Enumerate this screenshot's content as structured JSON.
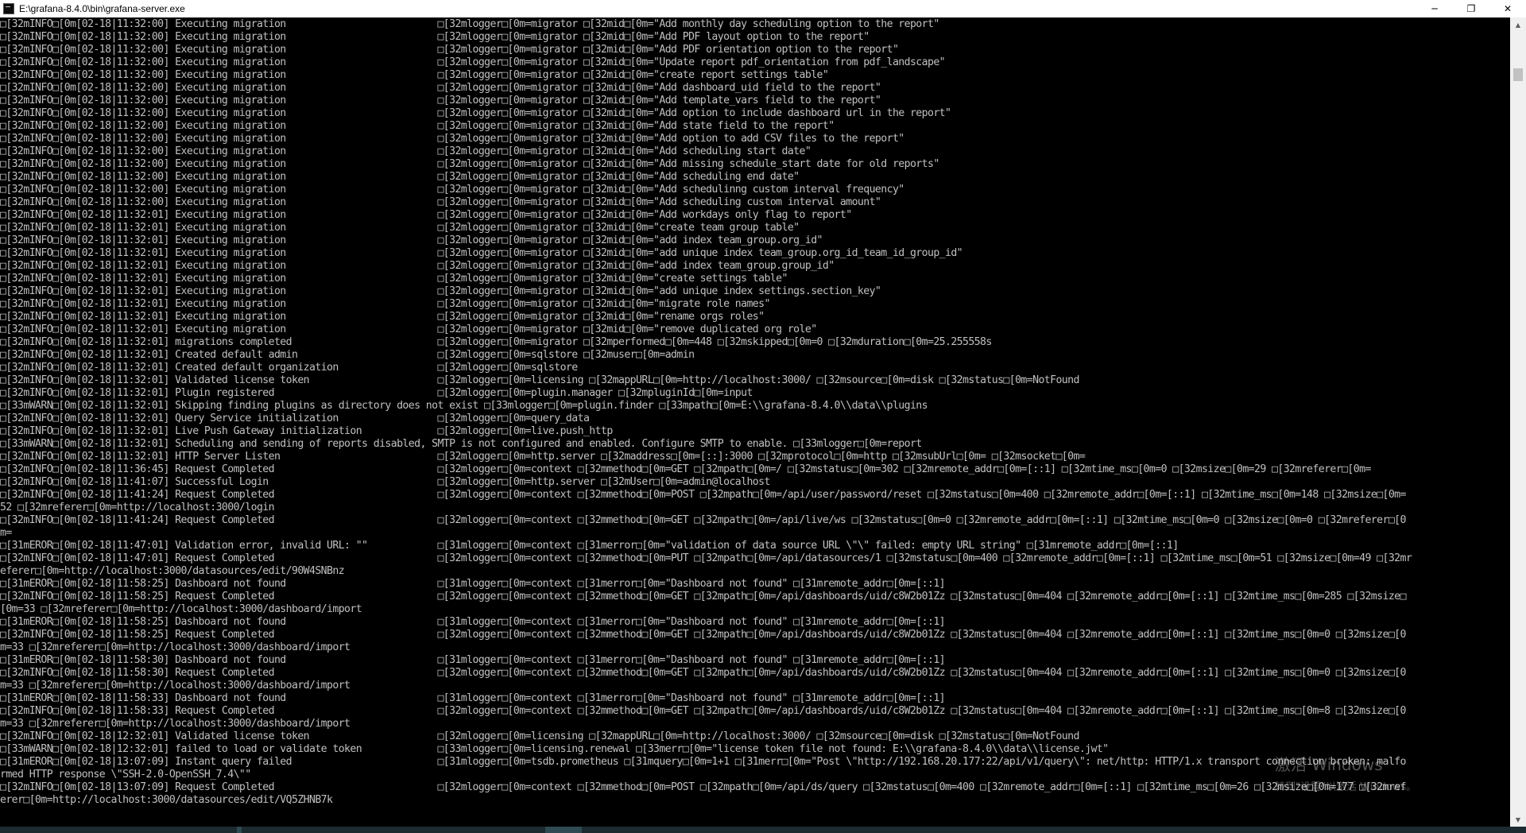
{
  "window": {
    "title": "E:\\grafana-8.4.0\\bin\\grafana-server.exe",
    "minimize_glyph": "─",
    "maximize_glyph": "❐",
    "close_glyph": "✕"
  },
  "console": {
    "lines": [
      "□[32mINFO□[0m[02-18|11:32:00] Executing migration                          □[32mlogger□[0m=migrator □[32mid□[0m=\"Add monthly day scheduling option to the report\"",
      "□[32mINFO□[0m[02-18|11:32:00] Executing migration                          □[32mlogger□[0m=migrator □[32mid□[0m=\"Add PDF layout option to the report\"",
      "□[32mINFO□[0m[02-18|11:32:00] Executing migration                          □[32mlogger□[0m=migrator □[32mid□[0m=\"Add PDF orientation option to the report\"",
      "□[32mINFO□[0m[02-18|11:32:00] Executing migration                          □[32mlogger□[0m=migrator □[32mid□[0m=\"Update report pdf_orientation from pdf_landscape\"",
      "□[32mINFO□[0m[02-18|11:32:00] Executing migration                          □[32mlogger□[0m=migrator □[32mid□[0m=\"create report settings table\"",
      "□[32mINFO□[0m[02-18|11:32:00] Executing migration                          □[32mlogger□[0m=migrator □[32mid□[0m=\"Add dashboard_uid field to the report\"",
      "□[32mINFO□[0m[02-18|11:32:00] Executing migration                          □[32mlogger□[0m=migrator □[32mid□[0m=\"Add template_vars field to the report\"",
      "□[32mINFO□[0m[02-18|11:32:00] Executing migration                          □[32mlogger□[0m=migrator □[32mid□[0m=\"Add option to include dashboard url in the report\"",
      "□[32mINFO□[0m[02-18|11:32:00] Executing migration                          □[32mlogger□[0m=migrator □[32mid□[0m=\"Add state field to the report\"",
      "□[32mINFO□[0m[02-18|11:32:00] Executing migration                          □[32mlogger□[0m=migrator □[32mid□[0m=\"Add option to add CSV files to the report\"",
      "□[32mINFO□[0m[02-18|11:32:00] Executing migration                          □[32mlogger□[0m=migrator □[32mid□[0m=\"Add scheduling start date\"",
      "□[32mINFO□[0m[02-18|11:32:00] Executing migration                          □[32mlogger□[0m=migrator □[32mid□[0m=\"Add missing schedule_start date for old reports\"",
      "□[32mINFO□[0m[02-18|11:32:00] Executing migration                          □[32mlogger□[0m=migrator □[32mid□[0m=\"Add scheduling end date\"",
      "□[32mINFO□[0m[02-18|11:32:00] Executing migration                          □[32mlogger□[0m=migrator □[32mid□[0m=\"Add schedulinng custom interval frequency\"",
      "□[32mINFO□[0m[02-18|11:32:00] Executing migration                          □[32mlogger□[0m=migrator □[32mid□[0m=\"Add scheduling custom interval amount\"",
      "□[32mINFO□[0m[02-18|11:32:01] Executing migration                          □[32mlogger□[0m=migrator □[32mid□[0m=\"Add workdays only flag to report\"",
      "□[32mINFO□[0m[02-18|11:32:01] Executing migration                          □[32mlogger□[0m=migrator □[32mid□[0m=\"create team group table\"",
      "□[32mINFO□[0m[02-18|11:32:01] Executing migration                          □[32mlogger□[0m=migrator □[32mid□[0m=\"add index team_group.org_id\"",
      "□[32mINFO□[0m[02-18|11:32:01] Executing migration                          □[32mlogger□[0m=migrator □[32mid□[0m=\"add unique index team_group.org_id_team_id_group_id\"",
      "□[32mINFO□[0m[02-18|11:32:01] Executing migration                          □[32mlogger□[0m=migrator □[32mid□[0m=\"add index team_group.group_id\"",
      "□[32mINFO□[0m[02-18|11:32:01] Executing migration                          □[32mlogger□[0m=migrator □[32mid□[0m=\"create settings table\"",
      "□[32mINFO□[0m[02-18|11:32:01] Executing migration                          □[32mlogger□[0m=migrator □[32mid□[0m=\"add unique index settings.section_key\"",
      "□[32mINFO□[0m[02-18|11:32:01] Executing migration                          □[32mlogger□[0m=migrator □[32mid□[0m=\"migrate role names\"",
      "□[32mINFO□[0m[02-18|11:32:01] Executing migration                          □[32mlogger□[0m=migrator □[32mid□[0m=\"rename orgs roles\"",
      "□[32mINFO□[0m[02-18|11:32:01] Executing migration                          □[32mlogger□[0m=migrator □[32mid□[0m=\"remove duplicated org role\"",
      "□[32mINFO□[0m[02-18|11:32:01] migrations completed                         □[32mlogger□[0m=migrator □[32mperformed□[0m=448 □[32mskipped□[0m=0 □[32mduration□[0m=25.255558s",
      "□[32mINFO□[0m[02-18|11:32:01] Created default admin                        □[32mlogger□[0m=sqlstore □[32muser□[0m=admin",
      "□[32mINFO□[0m[02-18|11:32:01] Created default organization                 □[32mlogger□[0m=sqlstore",
      "□[32mINFO□[0m[02-18|11:32:01] Validated license token                      □[32mlogger□[0m=licensing □[32mappURL□[0m=http://localhost:3000/ □[32msource□[0m=disk □[32mstatus□[0m=NotFound",
      "□[32mINFO□[0m[02-18|11:32:01] Plugin registered                            □[32mlogger□[0m=plugin.manager □[32mpluginId□[0m=input",
      "□[33mWARN□[0m[02-18|11:32:01] Skipping finding plugins as directory does not exist □[33mlogger□[0m=plugin.finder □[33mpath□[0m=E:\\\\grafana-8.4.0\\\\data\\\\plugins",
      "□[32mINFO□[0m[02-18|11:32:01] Query Service initialization                 □[32mlogger□[0m=query_data",
      "□[32mINFO□[0m[02-18|11:32:01] Live Push Gateway initialization             □[32mlogger□[0m=live.push_http",
      "□[33mWARN□[0m[02-18|11:32:01] Scheduling and sending of reports disabled, SMTP is not configured and enabled. Configure SMTP to enable. □[33mlogger□[0m=report",
      "□[32mINFO□[0m[02-18|11:32:01] HTTP Server Listen                           □[32mlogger□[0m=http.server □[32maddress□[0m=[::]:3000 □[32mprotocol□[0m=http □[32msubUrl□[0m= □[32msocket□[0m=",
      "□[32mINFO□[0m[02-18|11:36:45] Request Completed                            □[32mlogger□[0m=context □[32mmethod□[0m=GET □[32mpath□[0m=/ □[32mstatus□[0m=302 □[32mremote_addr□[0m=[::1] □[32mtime_ms□[0m=0 □[32msize□[0m=29 □[32mreferer□[0m=",
      "□[32mINFO□[0m[02-18|11:41:07] Successful Login                             □[32mlogger□[0m=http.server □[32mUser□[0m=admin@localhost",
      "□[32mINFO□[0m[02-18|11:41:24] Request Completed                            □[32mlogger□[0m=context □[32mmethod□[0m=POST □[32mpath□[0m=/api/user/password/reset □[32mstatus□[0m=400 □[32mremote_addr□[0m=[::1] □[32mtime_ms□[0m=148 □[32msize□[0m=",
      "52 □[32mreferer□[0m=http://localhost:3000/login",
      "□[32mINFO□[0m[02-18|11:41:24] Request Completed                            □[32mlogger□[0m=context □[32mmethod□[0m=GET □[32mpath□[0m=/api/live/ws □[32mstatus□[0m=0 □[32mremote_addr□[0m=[::1] □[32mtime_ms□[0m=0 □[32msize□[0m=0 □[32mreferer□[0",
      "m=",
      "□[31mEROR□[0m[02-18|11:47:01] Validation error, invalid URL: \"\"            □[31mlogger□[0m=context □[31merror□[0m=\"validation of data source URL \\\"\\\" failed: empty URL string\" □[31mremote_addr□[0m=[::1]",
      "□[32mINFO□[0m[02-18|11:47:01] Request Completed                            □[32mlogger□[0m=context □[32mmethod□[0m=PUT □[32mpath□[0m=/api/datasources/1 □[32mstatus□[0m=400 □[32mremote_addr□[0m=[::1] □[32mtime_ms□[0m=51 □[32msize□[0m=49 □[32mr",
      "eferer□[0m=http://localhost:3000/datasources/edit/90W4SNBnz",
      "□[31mEROR□[0m[02-18|11:58:25] Dashboard not found                          □[31mlogger□[0m=context □[31merror□[0m=\"Dashboard not found\" □[31mremote_addr□[0m=[::1]",
      "□[32mINFO□[0m[02-18|11:58:25] Request Completed                            □[32mlogger□[0m=context □[32mmethod□[0m=GET □[32mpath□[0m=/api/dashboards/uid/c8W2b01Zz □[32mstatus□[0m=404 □[32mremote_addr□[0m=[::1] □[32mtime_ms□[0m=285 □[32msize□",
      "[0m=33 □[32mreferer□[0m=http://localhost:3000/dashboard/import",
      "□[31mEROR□[0m[02-18|11:58:25] Dashboard not found                          □[31mlogger□[0m=context □[31merror□[0m=\"Dashboard not found\" □[31mremote_addr□[0m=[::1]",
      "□[32mINFO□[0m[02-18|11:58:25] Request Completed                            □[32mlogger□[0m=context □[32mmethod□[0m=GET □[32mpath□[0m=/api/dashboards/uid/c8W2b01Zz □[32mstatus□[0m=404 □[32mremote_addr□[0m=[::1] □[32mtime_ms□[0m=0 □[32msize□[0",
      "m=33 □[32mreferer□[0m=http://localhost:3000/dashboard/import",
      "□[31mEROR□[0m[02-18|11:58:30] Dashboard not found                          □[31mlogger□[0m=context □[31merror□[0m=\"Dashboard not found\" □[31mremote_addr□[0m=[::1]",
      "□[32mINFO□[0m[02-18|11:58:30] Request Completed                            □[32mlogger□[0m=context □[32mmethod□[0m=GET □[32mpath□[0m=/api/dashboards/uid/c8W2b01Zz □[32mstatus□[0m=404 □[32mremote_addr□[0m=[::1] □[32mtime_ms□[0m=0 □[32msize□[0",
      "m=33 □[32mreferer□[0m=http://localhost:3000/dashboard/import",
      "□[31mEROR□[0m[02-18|11:58:33] Dashboard not found                          □[31mlogger□[0m=context □[31merror□[0m=\"Dashboard not found\" □[31mremote_addr□[0m=[::1]",
      "□[32mINFO□[0m[02-18|11:58:33] Request Completed                            □[32mlogger□[0m=context □[32mmethod□[0m=GET □[32mpath□[0m=/api/dashboards/uid/c8W2b01Zz □[32mstatus□[0m=404 □[32mremote_addr□[0m=[::1] □[32mtime_ms□[0m=8 □[32msize□[0",
      "m=33 □[32mreferer□[0m=http://localhost:3000/dashboard/import",
      "□[32mINFO□[0m[02-18|12:32:01] Validated license token                      □[32mlogger□[0m=licensing □[32mappURL□[0m=http://localhost:3000/ □[32msource□[0m=disk □[32mstatus□[0m=NotFound",
      "□[33mWARN□[0m[02-18|12:32:01] failed to load or validate token             □[33mlogger□[0m=licensing.renewal □[33merr□[0m=\"license token file not found: E:\\\\grafana-8.4.0\\\\data\\\\license.jwt\"",
      "□[31mEROR□[0m[02-18|13:07:09] Instant query failed                         □[31mlogger□[0m=tsdb.prometheus □[31mquery□[0m=1+1 □[31merr□[0m=\"Post \\\"http://192.168.20.177:22/api/v1/query\\\": net/http: HTTP/1.x transport connection broken: malfo",
      "rmed HTTP response \\\"SSH-2.0-OpenSSH_7.4\\\"\"",
      "□[32mINFO□[0m[02-18|13:07:09] Request Completed                            □[32mlogger□[0m=context □[32mmethod□[0m=POST □[32mpath□[0m=/api/ds/query □[32mstatus□[0m=400 □[32mremote_addr□[0m=[::1] □[32mtime_ms□[0m=26 □[32msize□[0m=177 □[32mref",
      "erer□[0m=http://localhost:3000/datasources/edit/VQ5ZHNB7k"
    ]
  },
  "watermark": {
    "line1": "激活 Windows",
    "line2": "转到\"设置\"以激活 Windows。"
  }
}
